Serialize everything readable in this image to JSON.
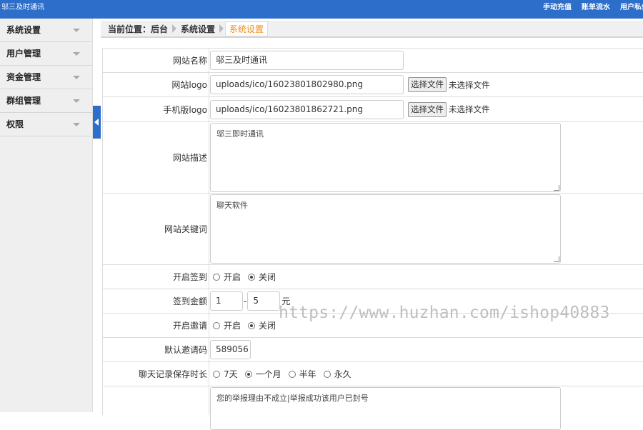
{
  "header": {
    "brand": "邬三及时通讯",
    "links": [
      "手动充值",
      "账单流水",
      "用户私信"
    ]
  },
  "sidebar": {
    "items": [
      {
        "label": "系统设置"
      },
      {
        "label": "用户管理"
      },
      {
        "label": "资金管理"
      },
      {
        "label": "群组管理"
      },
      {
        "label": "权限"
      }
    ]
  },
  "breadcrumb": {
    "prefix": "当前位置：后台",
    "section": "系统设置",
    "current": "系统设置"
  },
  "form": {
    "site_name": {
      "label": "网站名称",
      "value": "邬三及时通讯"
    },
    "site_logo": {
      "label": "网站logo",
      "value": "uploads/ico/16023801802980.png",
      "button": "选择文件",
      "status": "未选择文件"
    },
    "mobile_logo": {
      "label": "手机版logo",
      "value": "uploads/ico/16023801862721.png",
      "button": "选择文件",
      "status": "未选择文件"
    },
    "site_desc": {
      "label": "网站描述",
      "value": "邬三即时通讯"
    },
    "site_keywords": {
      "label": "网站关键词",
      "value": "聊天软件"
    },
    "sign_in": {
      "label": "开启签到",
      "options": [
        "开启",
        "关闭"
      ],
      "selected": "关闭"
    },
    "sign_amount": {
      "label": "签到金额",
      "min": "1",
      "sep": "-",
      "max": "5",
      "unit": "元"
    },
    "invite": {
      "label": "开启邀请",
      "options": [
        "开启",
        "关闭"
      ],
      "selected": "关闭"
    },
    "invite_code": {
      "label": "默认邀请码",
      "value": "589056"
    },
    "chat_retention": {
      "label": "聊天记录保存时长",
      "options": [
        "7天",
        "一个月",
        "半年",
        "永久"
      ],
      "selected": "一个月"
    },
    "report_text": {
      "label": "",
      "value": "您的举报理由不成立|举报成功该用户已封号"
    }
  },
  "watermark": "https://www.huzhan.com/ishop40883",
  "colors": {
    "topbar": "#2d6ecb",
    "crumb_current": "#f08b1a"
  }
}
